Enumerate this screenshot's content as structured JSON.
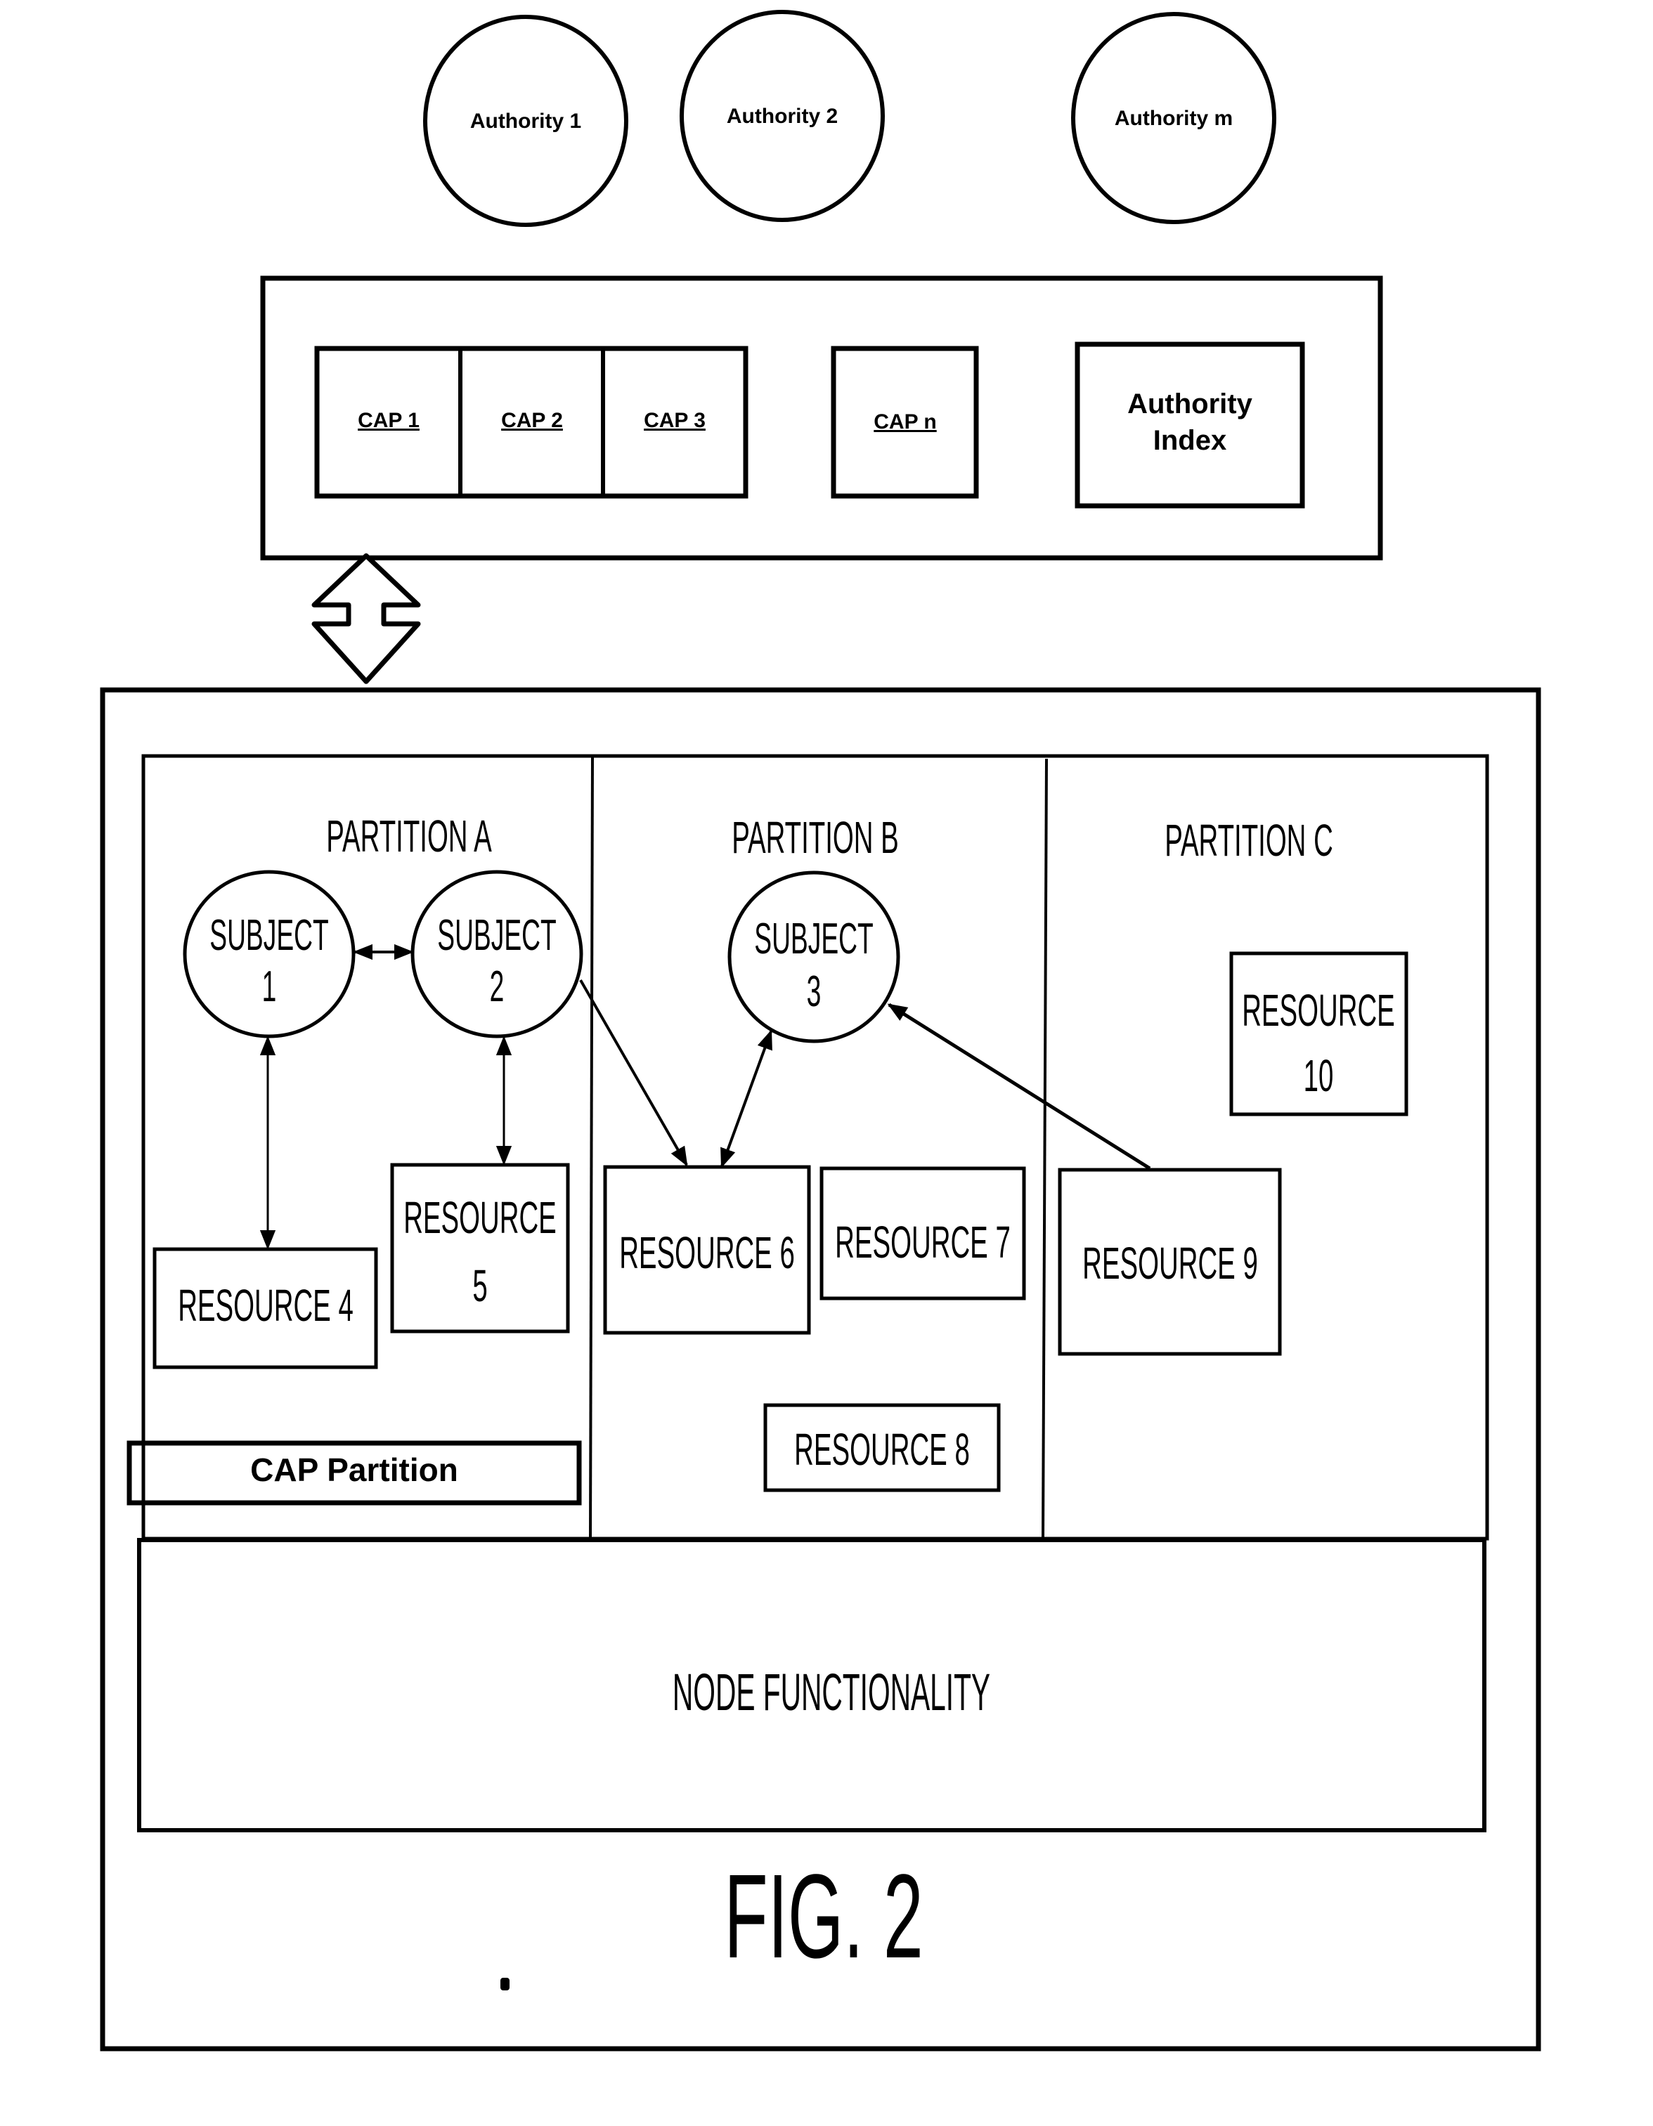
{
  "figure": {
    "caption": "FIG. 2"
  },
  "authorities": [
    {
      "label": "Authority 1"
    },
    {
      "label": "Authority 2"
    },
    {
      "label": "Authority m"
    }
  ],
  "cap_store": {
    "caps": [
      {
        "label": "CAP 1"
      },
      {
        "label": "CAP 2"
      },
      {
        "label": "CAP 3"
      },
      {
        "label": "CAP n"
      }
    ],
    "authority_index": {
      "line1": "Authority",
      "line2": "Index"
    }
  },
  "node": {
    "partitions": [
      {
        "label": "PARTITION A"
      },
      {
        "label": "PARTITION B"
      },
      {
        "label": "PARTITION C"
      }
    ],
    "subjects": [
      {
        "line1": "SUBJECT",
        "line2": "1"
      },
      {
        "line1": "SUBJECT",
        "line2": "2"
      },
      {
        "line1": "SUBJECT",
        "line2": "3"
      }
    ],
    "resources": {
      "r4": "RESOURCE 4",
      "r5_line1": "RESOURCE",
      "r5_line2": "5",
      "r6": "RESOURCE 6",
      "r7": "RESOURCE 7",
      "r8": "RESOURCE 8",
      "r9": "RESOURCE 9",
      "r10_line1": "RESOURCE",
      "r10_line2": "10"
    },
    "cap_partition": "CAP Partition",
    "node_functionality": "NODE FUNCTIONALITY"
  }
}
